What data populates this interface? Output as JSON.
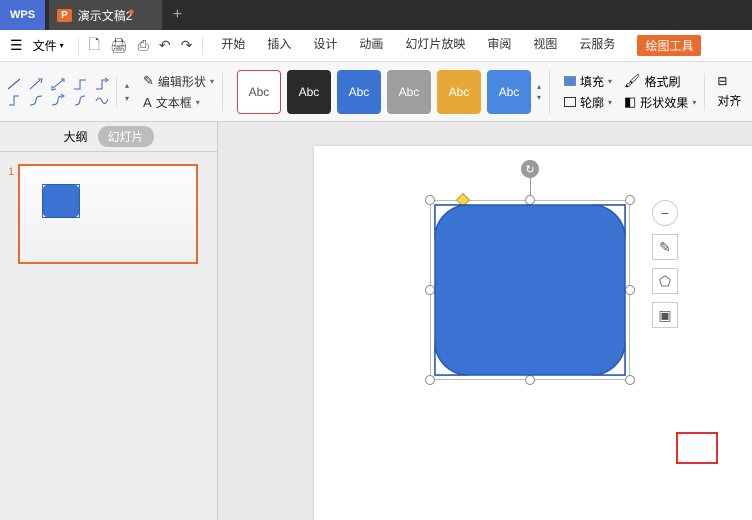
{
  "title": {
    "app": "WPS",
    "doc": "演示文稿2",
    "doc_icon": "P"
  },
  "menu": {
    "file": "文件",
    "tabs": [
      "开始",
      "插入",
      "设计",
      "动画",
      "幻灯片放映",
      "审阅",
      "视图",
      "云服务"
    ],
    "drawing": "绘图工具"
  },
  "ribbon": {
    "edit_shape": "编辑形状",
    "text_box": "文本框",
    "style_label": "Abc",
    "fill": "填充",
    "format_painter": "格式刷",
    "outline": "轮廓",
    "shape_effect": "形状效果",
    "align": "对齐"
  },
  "sidebar": {
    "outline_tab": "大纲",
    "slides_tab": "幻灯片",
    "slide_num": "1"
  },
  "float": {
    "minus": "−",
    "dropper": "✎",
    "bucket": "⬠",
    "layers": "▣"
  }
}
